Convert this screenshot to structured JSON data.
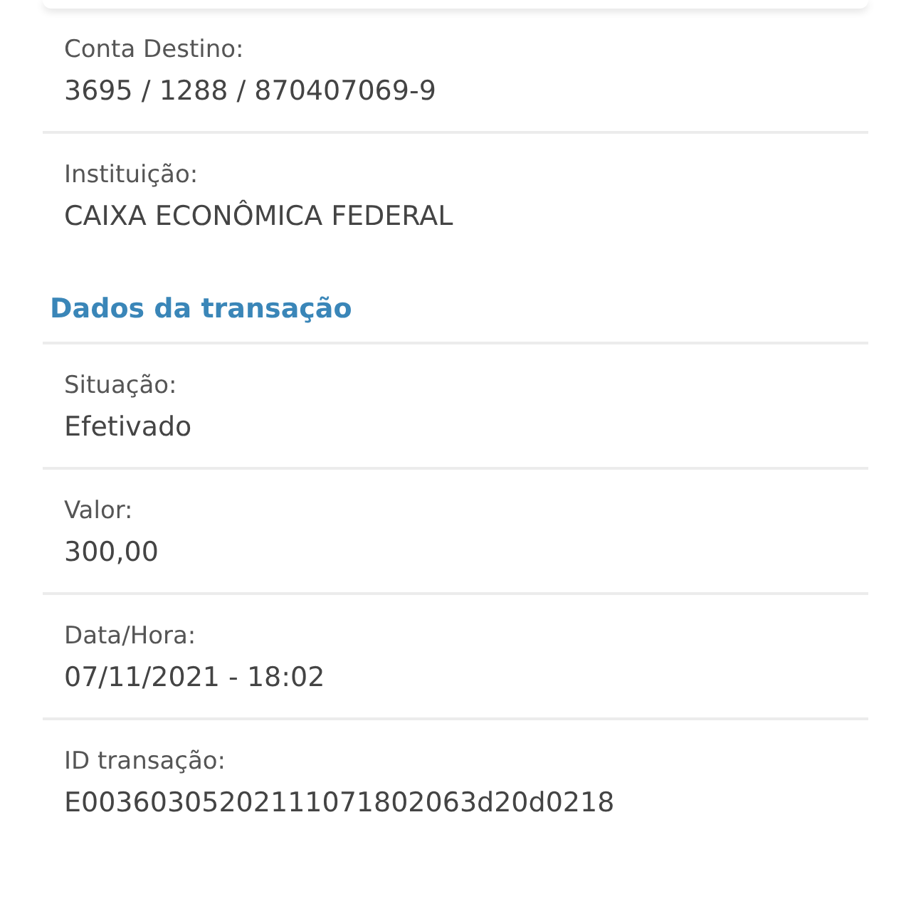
{
  "account_fields": [
    {
      "label": "Conta Destino:",
      "value": "3695 / 1288 / 870407069-9"
    },
    {
      "label": "Instituição:",
      "value": "CAIXA ECONÔMICA FEDERAL"
    }
  ],
  "transaction_section": {
    "title": "Dados da transação",
    "fields": [
      {
        "label": "Situação:",
        "value": "Efetivado"
      },
      {
        "label": "Valor:",
        "value": "300,00"
      },
      {
        "label": "Data/Hora:",
        "value": "07/11/2021 - 18:02"
      },
      {
        "label": "ID transação:",
        "value": "E00360305202111071802063d20d0218"
      }
    ]
  }
}
